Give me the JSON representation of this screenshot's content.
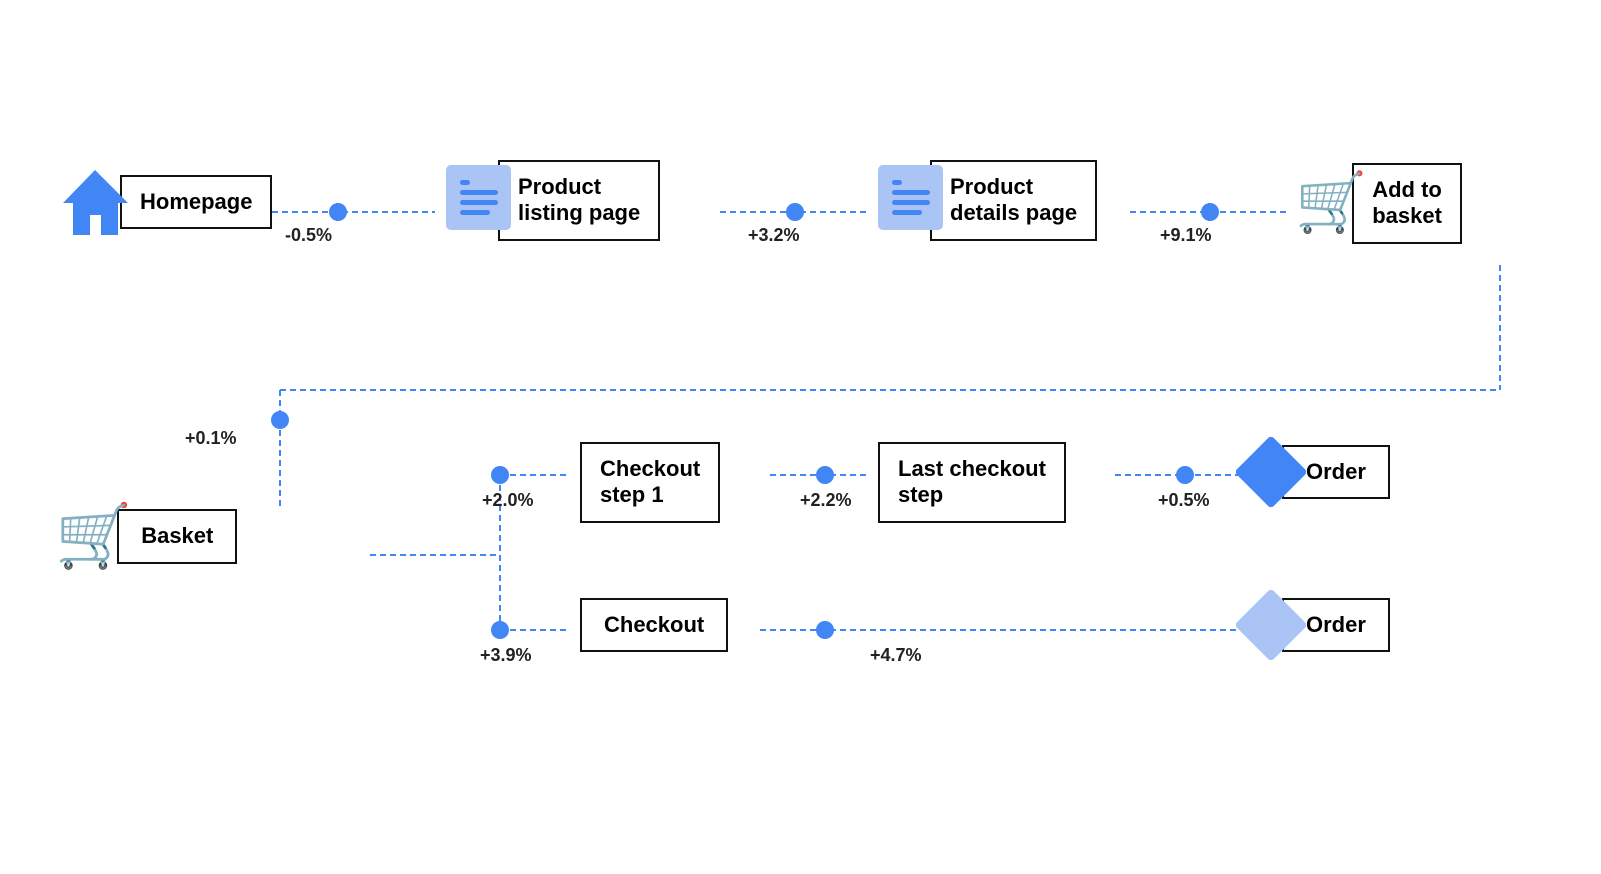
{
  "nodes": {
    "homepage": {
      "label": "Homepage"
    },
    "product_listing": {
      "label": "Product\nlisting page"
    },
    "product_details": {
      "label": "Product\ndetails page"
    },
    "add_to_basket": {
      "label": "Add to\nbasket"
    },
    "basket": {
      "label": "Basket"
    },
    "checkout_step1": {
      "label": "Checkout\nstep 1"
    },
    "last_checkout": {
      "label": "Last checkout\nstep"
    },
    "order1": {
      "label": "Order"
    },
    "checkout": {
      "label": "Checkout"
    },
    "order2": {
      "label": "Order"
    }
  },
  "edges": {
    "home_to_listing": {
      "label": "-0.5%"
    },
    "listing_to_details": {
      "label": "+3.2%"
    },
    "details_to_basket_add": {
      "label": "+9.1%"
    },
    "basket_loop": {
      "label": "+0.1%"
    },
    "basket_to_step1": {
      "label": "+2.0%"
    },
    "step1_to_last": {
      "label": "+2.2%"
    },
    "last_to_order1": {
      "label": "+0.5%"
    },
    "basket_to_checkout": {
      "label": "+3.9%"
    },
    "checkout_to_order2": {
      "label": "+4.7%"
    }
  },
  "colors": {
    "blue": "#4285f4",
    "light_blue": "#aac4f5",
    "black": "#111111",
    "edge_line": "#4285f4"
  }
}
